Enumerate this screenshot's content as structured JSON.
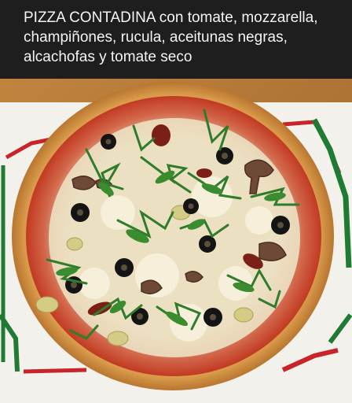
{
  "post": {
    "caption": "PIZZA CONTADINA con tomate, mozzarella, champiñones, rucula, aceitunas negras, alcachofas y tomate seco"
  },
  "photo": {
    "subject": "pizza-contadina",
    "colors": {
      "table": "#b5773a",
      "placemat": "#f3f1ec",
      "placemat_stripe_green": "#1f7a34",
      "placemat_stripe_red": "#c8242a",
      "crust": "#e7b46a",
      "sauce": "#c9452a",
      "cheese": "#efe3c4",
      "arugula": "#2f7d2a",
      "olive": "#141414",
      "mushroom": "#6e4a36",
      "artichoke": "#c9c27a",
      "dried_tomato": "#7a2016"
    }
  }
}
